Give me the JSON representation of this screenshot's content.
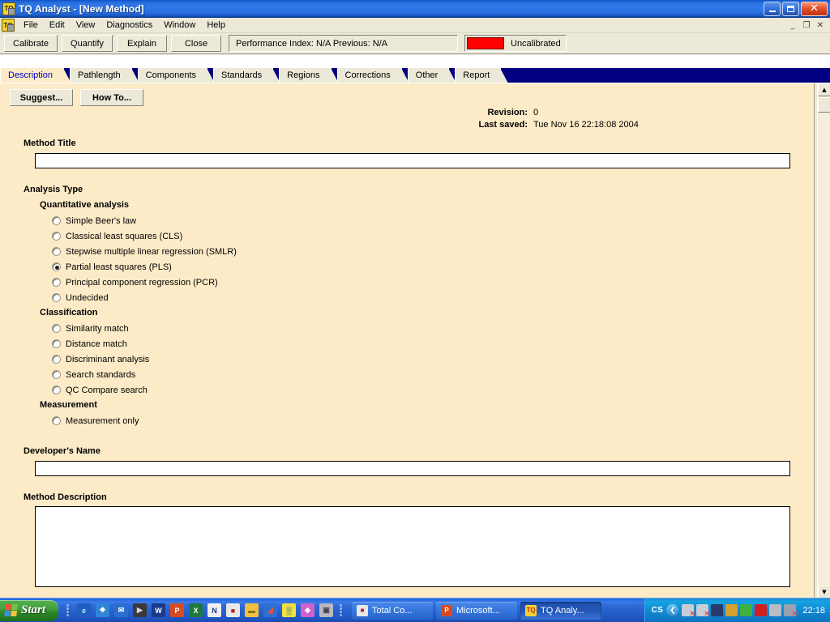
{
  "window": {
    "title": "TQ Analyst  - [New Method]",
    "app_icon": "tq-document-icon",
    "controls": {
      "minimize": "minimize-icon",
      "maximize": "maximize-icon",
      "close": "close-icon"
    },
    "mdi_controls": {
      "minimize": "_",
      "restore": "❐",
      "close": "✕"
    }
  },
  "menu": {
    "items": [
      "File",
      "Edit",
      "View",
      "Diagnostics",
      "Window",
      "Help"
    ]
  },
  "toolbar": {
    "buttons": [
      "Calibrate",
      "Quantify",
      "Explain",
      "Close"
    ],
    "performance_index": "Performance Index:  N/A  Previous:  N/A",
    "calibration_status": "Uncalibrated",
    "calibration_color": "#ff0000"
  },
  "tabs": {
    "items": [
      "Description",
      "Pathlength",
      "Components",
      "Standards",
      "Regions",
      "Corrections",
      "Other",
      "Report"
    ],
    "active": "Description",
    "strip_color": "#000080"
  },
  "pane": {
    "buttons": [
      "Suggest...",
      "How To..."
    ],
    "meta": [
      {
        "key": "Revision:",
        "value": "0"
      },
      {
        "key": "Last saved:",
        "value": "Tue Nov 16 22:18:08 2004"
      }
    ],
    "method_title_label": "Method Title",
    "method_title_value": "",
    "analysis_type_label": "Analysis Type",
    "groups": [
      {
        "heading": "Quantitative analysis",
        "options": [
          {
            "label": "Simple Beer's law",
            "selected": false
          },
          {
            "label": "Classical least squares (CLS)",
            "selected": false
          },
          {
            "label": "Stepwise multiple linear regression (SMLR)",
            "selected": false
          },
          {
            "label": "Partial least squares (PLS)",
            "selected": true
          },
          {
            "label": "Principal component regression (PCR)",
            "selected": false
          },
          {
            "label": "Undecided",
            "selected": false
          }
        ]
      },
      {
        "heading": "Classification",
        "options": [
          {
            "label": "Similarity match",
            "selected": false
          },
          {
            "label": "Distance match",
            "selected": false
          },
          {
            "label": "Discriminant analysis",
            "selected": false
          },
          {
            "label": "Search standards",
            "selected": false
          },
          {
            "label": "QC Compare search",
            "selected": false
          }
        ]
      },
      {
        "heading": "Measurement",
        "options": [
          {
            "label": "Measurement only",
            "selected": false
          }
        ]
      }
    ],
    "developer_label": "Developer's Name",
    "developer_value": "",
    "description_label": "Method Description",
    "description_value": ""
  },
  "scrollbar": {
    "up": "▲",
    "down": "▼"
  },
  "taskbar": {
    "start_label": "Start",
    "quicklaunch": [
      {
        "name": "internet-explorer-icon",
        "glyph": "e",
        "bg": "#1f5fbf",
        "fg": "#bfe0ff"
      },
      {
        "name": "show-desktop-icon",
        "glyph": "❖",
        "bg": "#2f86d8",
        "fg": "#ffffff"
      },
      {
        "name": "outlook-express-icon",
        "glyph": "✉",
        "bg": "#2a6fd0",
        "fg": "#ffffff"
      },
      {
        "name": "media-player-icon",
        "glyph": "▶",
        "bg": "#3a3a3a",
        "fg": "#d8d8d8"
      },
      {
        "name": "word-icon",
        "glyph": "W",
        "bg": "#1b3a8c",
        "fg": "#ffffff"
      },
      {
        "name": "powerpoint-icon",
        "glyph": "P",
        "bg": "#d84a20",
        "fg": "#ffffff"
      },
      {
        "name": "excel-icon",
        "glyph": "X",
        "bg": "#1e7a3c",
        "fg": "#ffffff"
      },
      {
        "name": "netscape-icon",
        "glyph": "N",
        "bg": "#f0f0f0",
        "fg": "#1b3a8c"
      },
      {
        "name": "save-disk-icon",
        "glyph": "■",
        "bg": "#e8e8e8",
        "fg": "#c02020"
      },
      {
        "name": "folder-icon",
        "glyph": "▬",
        "bg": "#f0c040",
        "fg": "#8a6a10"
      },
      {
        "name": "paint-icon",
        "glyph": "◢",
        "bg": "#2f6fd0",
        "fg": "#f05030"
      },
      {
        "name": "office-icon",
        "glyph": "▒",
        "bg": "#f0e040",
        "fg": "#2050a0"
      },
      {
        "name": "diamond-icon",
        "glyph": "◆",
        "bg": "#d060d0",
        "fg": "#ffffff"
      },
      {
        "name": "monitor-icon",
        "glyph": "▣",
        "bg": "#b8b8c0",
        "fg": "#404050"
      }
    ],
    "tasks": [
      {
        "label": "Total Co...",
        "icon_glyph": "■",
        "icon_bg": "#e8e8e8",
        "icon_fg": "#c02020",
        "active": false
      },
      {
        "label": "Microsoft...",
        "icon_glyph": "P",
        "icon_bg": "#d84a20",
        "icon_fg": "#ffffff",
        "active": false
      },
      {
        "label": "TQ Analy...",
        "icon_glyph": "TQ",
        "icon_bg": "#f3d431",
        "icon_fg": "#c02020",
        "active": true
      }
    ],
    "tray": {
      "text": "CS",
      "chevron": "❮",
      "icons": [
        {
          "name": "network-disconnected-icon",
          "bg": "#c8ccd4",
          "x": true
        },
        {
          "name": "network-activity-icon",
          "bg": "#c8ccd4",
          "x": true
        },
        {
          "name": "battery-icon",
          "bg": "#2a3a6a",
          "x": false
        },
        {
          "name": "antivirus-icon",
          "bg": "#d8a030",
          "x": false
        },
        {
          "name": "display-settings-icon",
          "bg": "#40b040",
          "x": false
        },
        {
          "name": "update-icon",
          "bg": "#d02020",
          "x": false
        },
        {
          "name": "monitor-icon",
          "bg": "#b8bcc4",
          "x": false
        },
        {
          "name": "volume-muted-icon",
          "bg": "#9aa0b0",
          "x": true
        }
      ],
      "clock": "22:18"
    }
  }
}
